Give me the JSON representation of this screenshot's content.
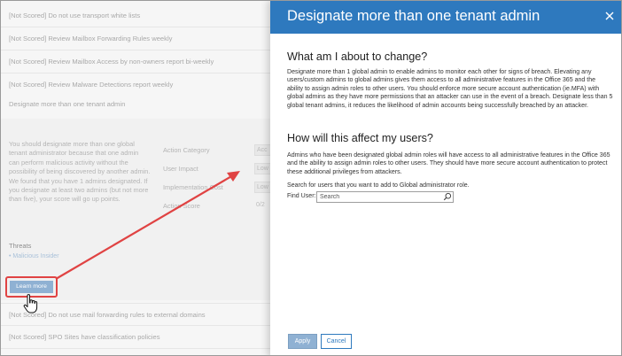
{
  "colors": {
    "header_blue": "#2e79be",
    "primary_button": "#8fb1d3",
    "highlight_red": "#e04343",
    "muted_text": "#a9a9a9"
  },
  "background": {
    "list_items": [
      "[Not Scored] Do not use transport white lists",
      "[Not Scored] Review Mailbox Forwarding Rules weekly",
      "[Not Scored] Review Mailbox Access by non-owners report bi-weekly",
      "[Not Scored] Review Malware Detections report weekly",
      "Designate more than one tenant admin"
    ],
    "details": {
      "description": "You should designate more than one global tenant administrator because that one admin can perform malicious activity without the possibility of being discovered by another admin. We found that you have 1 admins designated. If you designate at least two admins (but not more than five), your score will go up points.",
      "meta": [
        {
          "label": "Action Category",
          "value": "Acc"
        },
        {
          "label": "User Impact",
          "value": "Low"
        },
        {
          "label": "Implementation Cost",
          "value": "Low"
        },
        {
          "label": "Action Score",
          "value": "0/2"
        }
      ],
      "threats_title": "Threats",
      "threat_item": "• Malicious Insider",
      "learn_more_label": "Learn more"
    },
    "list_items_bottom": [
      "[Not Scored] Do not use mail forwarding rules to external domains",
      "[Not Scored] SPO Sites have classification policies"
    ],
    "icons": {
      "cursor": "hand-pointer-icon"
    }
  },
  "panel": {
    "title": "Designate more than one tenant admin",
    "close_icon": "close-icon",
    "section1_heading": "What am I about to change?",
    "section1_text": "Designate more than 1 global admin to enable admins to monitor each other for signs of breach. Elevating any users/custom admins to global admins gives them access to all administrative features in the Office 365 and the ability to assign admin roles to other users. You should enforce more secure account authentication (ie.MFA) with global admins as they have more permissions that an attacker can use in the event of a breach. Designate less than 5 global tenant admins, it reduces the likelihood of admin accounts being successfully breached by an attacker.",
    "section2_heading": "How will this affect my users?",
    "section2_text": "Admins who have been designated global admin roles will have access to all administrative features in the Office 365 and the ability to assign admin roles to other users. They should have more secure account authentication to protect these additional privileges from attackers.",
    "search_hint": "Search for users that you want to add to Global administrator role.",
    "find_user_label": "Find User:",
    "search_placeholder": "Search",
    "search_icon": "search-icon",
    "apply_label": "Apply",
    "cancel_label": "Cancel"
  }
}
